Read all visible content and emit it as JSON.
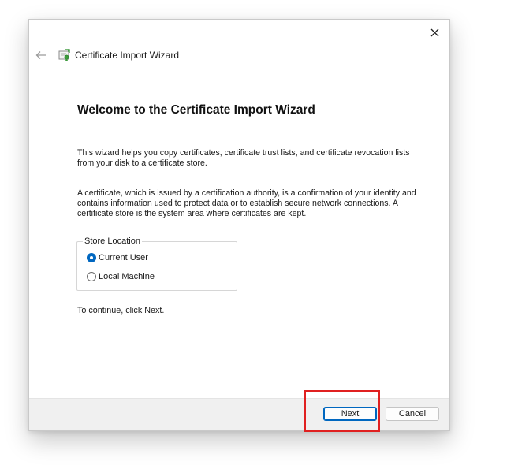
{
  "window": {
    "title": "Certificate Import Wizard"
  },
  "content": {
    "heading": "Welcome to the Certificate Import Wizard",
    "paragraph1": "This wizard helps you copy certificates, certificate trust lists, and certificate revocation lists from your disk to a certificate store.",
    "paragraph2": "A certificate, which is issued by a certification authority, is a confirmation of your identity and contains information used to protect data or to establish secure network connections. A certificate store is the system area where certificates are kept.",
    "store_location": {
      "legend": "Store Location",
      "options": [
        {
          "label": "Current User",
          "selected": true
        },
        {
          "label": "Local Machine",
          "selected": false
        }
      ]
    },
    "continue_text": "To continue, click Next."
  },
  "footer": {
    "next_label": "Next",
    "cancel_label": "Cancel"
  },
  "colors": {
    "accent": "#0067c0",
    "highlight": "#e02020",
    "footer_bg": "#f0f0f0"
  },
  "icons": {
    "back": "arrow-left-icon",
    "app": "certificate-icon",
    "close": "close-icon"
  }
}
